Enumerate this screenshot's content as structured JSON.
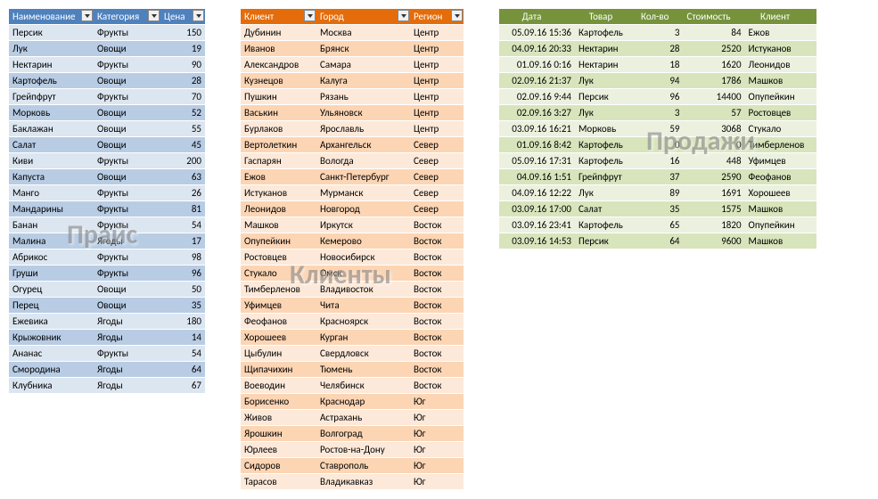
{
  "overlays": {
    "blue": "Прайс",
    "orange": "Клиенты",
    "green": "Продажи"
  },
  "blue": {
    "headers": [
      "Наименование",
      "Категория",
      "Цена"
    ],
    "rows": [
      [
        "Персик",
        "Фрукты",
        "150"
      ],
      [
        "Лук",
        "Овощи",
        "19"
      ],
      [
        "Нектарин",
        "Фрукты",
        "90"
      ],
      [
        "Картофель",
        "Овощи",
        "28"
      ],
      [
        "Грейпфрут",
        "Фрукты",
        "70"
      ],
      [
        "Морковь",
        "Овощи",
        "52"
      ],
      [
        "Баклажан",
        "Овощи",
        "55"
      ],
      [
        "Салат",
        "Овощи",
        "45"
      ],
      [
        "Киви",
        "Фрукты",
        "200"
      ],
      [
        "Капуста",
        "Овощи",
        "63"
      ],
      [
        "Манго",
        "Фрукты",
        "26"
      ],
      [
        "Мандарины",
        "Фрукты",
        "81"
      ],
      [
        "Банан",
        "Фрукты",
        "54"
      ],
      [
        "Малина",
        "Ягоды",
        "17"
      ],
      [
        "Абрикос",
        "Фрукты",
        "98"
      ],
      [
        "Груши",
        "Фрукты",
        "96"
      ],
      [
        "Огурец",
        "Овощи",
        "50"
      ],
      [
        "Перец",
        "Овощи",
        "35"
      ],
      [
        "Ежевика",
        "Ягоды",
        "180"
      ],
      [
        "Крыжовник",
        "Ягоды",
        "14"
      ],
      [
        "Ананас",
        "Фрукты",
        "54"
      ],
      [
        "Смородина",
        "Ягоды",
        "64"
      ],
      [
        "Клубника",
        "Ягоды",
        "67"
      ]
    ]
  },
  "orange": {
    "headers": [
      "Клиент",
      "Город",
      "Регион"
    ],
    "rows": [
      [
        "Дубинин",
        "Москва",
        "Центр"
      ],
      [
        "Иванов",
        "Брянск",
        "Центр"
      ],
      [
        "Александров",
        "Самара",
        "Центр"
      ],
      [
        "Кузнецов",
        "Калуга",
        "Центр"
      ],
      [
        "Пушкин",
        "Рязань",
        "Центр"
      ],
      [
        "Васькин",
        "Ульяновск",
        "Центр"
      ],
      [
        "Бурлаков",
        "Ярославль",
        "Центр"
      ],
      [
        "Вертолеткин",
        "Архангельск",
        "Север"
      ],
      [
        "Гаспарян",
        "Вологда",
        "Север"
      ],
      [
        "Ежов",
        "Санкт-Петербург",
        "Север"
      ],
      [
        "Истуканов",
        "Мурманск",
        "Север"
      ],
      [
        "Леонидов",
        "Новгород",
        "Север"
      ],
      [
        "Машков",
        "Иркутск",
        "Восток"
      ],
      [
        "Опупейкин",
        "Кемерово",
        "Восток"
      ],
      [
        "Ростовцев",
        "Новосибирск",
        "Восток"
      ],
      [
        "Стукало",
        "Омск",
        "Восток"
      ],
      [
        "Тимберленов",
        "Владивосток",
        "Восток"
      ],
      [
        "Уфимцев",
        "Чита",
        "Восток"
      ],
      [
        "Феофанов",
        "Красноярск",
        "Восток"
      ],
      [
        "Хорошеев",
        "Курган",
        "Восток"
      ],
      [
        "Цыбулин",
        "Свердловск",
        "Восток"
      ],
      [
        "Щипачихин",
        "Тюмень",
        "Восток"
      ],
      [
        "Воеводин",
        "Челябинск",
        "Восток"
      ],
      [
        "Борисенко",
        "Краснодар",
        "Юг"
      ],
      [
        "Живов",
        "Астрахань",
        "Юг"
      ],
      [
        "Ярошкин",
        "Волгоград",
        "Юг"
      ],
      [
        "Юрлеев",
        "Ростов-на-Дону",
        "Юг"
      ],
      [
        "Сидоров",
        "Ставрополь",
        "Юг"
      ],
      [
        "Тарасов",
        "Владикавказ",
        "Юг"
      ]
    ]
  },
  "green": {
    "headers": [
      "Дата",
      "Товар",
      "Кол-во",
      "Стоимость",
      "Клиент"
    ],
    "rows": [
      [
        "05.09.16 15:36",
        "Картофель",
        "3",
        "84",
        "Ежов"
      ],
      [
        "04.09.16 20:33",
        "Нектарин",
        "28",
        "2520",
        "Истуканов"
      ],
      [
        "01.09.16 0:16",
        "Нектарин",
        "18",
        "1620",
        "Леонидов"
      ],
      [
        "02.09.16 21:37",
        "Лук",
        "94",
        "1786",
        "Машков"
      ],
      [
        "02.09.16 9:44",
        "Персик",
        "96",
        "14400",
        "Опупейкин"
      ],
      [
        "02.09.16 3:27",
        "Лук",
        "3",
        "57",
        "Ростовцев"
      ],
      [
        "03.09.16 16:21",
        "Морковь",
        "59",
        "3068",
        "Стукало"
      ],
      [
        "01.09.16 8:42",
        "Картофель",
        "0",
        "0",
        "Тимберленов"
      ],
      [
        "05.09.16 17:31",
        "Картофель",
        "16",
        "448",
        "Уфимцев"
      ],
      [
        "04.09.16 1:51",
        "Грейпфрут",
        "37",
        "2590",
        "Феофанов"
      ],
      [
        "04.09.16 12:22",
        "Лук",
        "89",
        "1691",
        "Хорошеев"
      ],
      [
        "03.09.16 17:00",
        "Салат",
        "35",
        "1575",
        "Машков"
      ],
      [
        "03.09.16 23:41",
        "Картофель",
        "65",
        "1820",
        "Опупейкин"
      ],
      [
        "03.09.16 14:53",
        "Персик",
        "64",
        "9600",
        "Машков"
      ]
    ]
  },
  "chart_data": [
    {
      "type": "table",
      "title": "Прайс",
      "columns": [
        "Наименование",
        "Категория",
        "Цена"
      ],
      "rows": [
        {
          "Наименование": "Персик",
          "Категория": "Фрукты",
          "Цена": 150
        },
        {
          "Наименование": "Лук",
          "Категория": "Овощи",
          "Цена": 19
        },
        {
          "Наименование": "Нектарин",
          "Категория": "Фрукты",
          "Цена": 90
        },
        {
          "Наименование": "Картофель",
          "Категория": "Овощи",
          "Цена": 28
        },
        {
          "Наименование": "Грейпфрут",
          "Категория": "Фрукты",
          "Цена": 70
        },
        {
          "Наименование": "Морковь",
          "Категория": "Овощи",
          "Цена": 52
        },
        {
          "Наименование": "Баклажан",
          "Категория": "Овощи",
          "Цена": 55
        },
        {
          "Наименование": "Салат",
          "Категория": "Овощи",
          "Цена": 45
        },
        {
          "Наименование": "Киви",
          "Категория": "Фрукты",
          "Цена": 200
        },
        {
          "Наименование": "Капуста",
          "Категория": "Овощи",
          "Цена": 63
        },
        {
          "Наименование": "Манго",
          "Категория": "Фрукты",
          "Цена": 26
        },
        {
          "Наименование": "Мандарины",
          "Категория": "Фрукты",
          "Цена": 81
        },
        {
          "Наименование": "Банан",
          "Категория": "Фрукты",
          "Цена": 54
        },
        {
          "Наименование": "Малина",
          "Категория": "Ягоды",
          "Цена": 17
        },
        {
          "Наименование": "Абрикос",
          "Категория": "Фрукты",
          "Цена": 98
        },
        {
          "Наименование": "Груши",
          "Категория": "Фрукты",
          "Цена": 96
        },
        {
          "Наименование": "Огурец",
          "Категория": "Овощи",
          "Цена": 50
        },
        {
          "Наименование": "Перец",
          "Категория": "Овощи",
          "Цена": 35
        },
        {
          "Наименование": "Ежевика",
          "Категория": "Ягоды",
          "Цена": 180
        },
        {
          "Наименование": "Крыжовник",
          "Категория": "Ягоды",
          "Цена": 14
        },
        {
          "Наименование": "Ананас",
          "Категория": "Фрукты",
          "Цена": 54
        },
        {
          "Наименование": "Смородина",
          "Категория": "Ягоды",
          "Цена": 64
        },
        {
          "Наименование": "Клубника",
          "Категория": "Ягоды",
          "Цена": 67
        }
      ]
    },
    {
      "type": "table",
      "title": "Клиенты",
      "columns": [
        "Клиент",
        "Город",
        "Регион"
      ],
      "rows": [
        {
          "Клиент": "Дубинин",
          "Город": "Москва",
          "Регион": "Центр"
        },
        {
          "Клиент": "Иванов",
          "Город": "Брянск",
          "Регион": "Центр"
        },
        {
          "Клиент": "Александров",
          "Город": "Самара",
          "Регион": "Центр"
        },
        {
          "Клиент": "Кузнецов",
          "Город": "Калуга",
          "Регион": "Центр"
        },
        {
          "Клиент": "Пушкин",
          "Город": "Рязань",
          "Регион": "Центр"
        },
        {
          "Клиент": "Васькин",
          "Город": "Ульяновск",
          "Регион": "Центр"
        },
        {
          "Клиент": "Бурлаков",
          "Город": "Ярославль",
          "Регион": "Центр"
        },
        {
          "Клиент": "Вертолеткин",
          "Город": "Архангельск",
          "Регион": "Север"
        },
        {
          "Клиент": "Гаспарян",
          "Город": "Вологда",
          "Регион": "Север"
        },
        {
          "Клиент": "Ежов",
          "Город": "Санкт-Петербург",
          "Регион": "Север"
        },
        {
          "Клиент": "Истуканов",
          "Город": "Мурманск",
          "Регион": "Север"
        },
        {
          "Клиент": "Леонидов",
          "Город": "Новгород",
          "Регион": "Север"
        },
        {
          "Клиент": "Машков",
          "Город": "Иркутск",
          "Регион": "Восток"
        },
        {
          "Клиент": "Опупейкин",
          "Город": "Кемерово",
          "Регион": "Восток"
        },
        {
          "Клиент": "Ростовцев",
          "Город": "Новосибирск",
          "Регион": "Восток"
        },
        {
          "Клиент": "Стукало",
          "Город": "Омск",
          "Регион": "Восток"
        },
        {
          "Клиент": "Тимберленов",
          "Город": "Владивосток",
          "Регион": "Восток"
        },
        {
          "Клиент": "Уфимцев",
          "Город": "Чита",
          "Регион": "Восток"
        },
        {
          "Клиент": "Феофанов",
          "Город": "Красноярск",
          "Регион": "Восток"
        },
        {
          "Клиент": "Хорошеев",
          "Город": "Курган",
          "Регион": "Восток"
        },
        {
          "Клиент": "Цыбулин",
          "Город": "Свердловск",
          "Регион": "Восток"
        },
        {
          "Клиент": "Щипачихин",
          "Город": "Тюмень",
          "Регион": "Восток"
        },
        {
          "Клиент": "Воеводин",
          "Город": "Челябинск",
          "Регион": "Восток"
        },
        {
          "Клиент": "Борисенко",
          "Город": "Краснодар",
          "Регион": "Юг"
        },
        {
          "Клиент": "Живов",
          "Город": "Астрахань",
          "Регион": "Юг"
        },
        {
          "Клиент": "Ярошкин",
          "Город": "Волгоград",
          "Регион": "Юг"
        },
        {
          "Клиент": "Юрлеев",
          "Город": "Ростов-на-Дону",
          "Регион": "Юг"
        },
        {
          "Клиент": "Сидоров",
          "Город": "Ставрополь",
          "Регион": "Юг"
        },
        {
          "Клиент": "Тарасов",
          "Город": "Владикавказ",
          "Регион": "Юг"
        }
      ]
    },
    {
      "type": "table",
      "title": "Продажи",
      "columns": [
        "Дата",
        "Товар",
        "Кол-во",
        "Стоимость",
        "Клиент"
      ],
      "rows": [
        {
          "Дата": "05.09.16 15:36",
          "Товар": "Картофель",
          "Кол-во": 3,
          "Стоимость": 84,
          "Клиент": "Ежов"
        },
        {
          "Дата": "04.09.16 20:33",
          "Товар": "Нектарин",
          "Кол-во": 28,
          "Стоимость": 2520,
          "Клиент": "Истуканов"
        },
        {
          "Дата": "01.09.16 0:16",
          "Товар": "Нектарин",
          "Кол-во": 18,
          "Стоимость": 1620,
          "Клиент": "Леонидов"
        },
        {
          "Дата": "02.09.16 21:37",
          "Товар": "Лук",
          "Кол-во": 94,
          "Стоимость": 1786,
          "Клиент": "Машков"
        },
        {
          "Дата": "02.09.16 9:44",
          "Товар": "Персик",
          "Кол-во": 96,
          "Стоимость": 14400,
          "Клиент": "Опупейкин"
        },
        {
          "Дата": "02.09.16 3:27",
          "Товар": "Лук",
          "Кол-во": 3,
          "Стоимость": 57,
          "Клиент": "Ростовцев"
        },
        {
          "Дата": "03.09.16 16:21",
          "Товар": "Морковь",
          "Кол-во": 59,
          "Стоимость": 3068,
          "Клиент": "Стукало"
        },
        {
          "Дата": "01.09.16 8:42",
          "Товар": "Картофель",
          "Кол-во": 0,
          "Стоимость": 0,
          "Клиент": "Тимберленов"
        },
        {
          "Дата": "05.09.16 17:31",
          "Товар": "Картофель",
          "Кол-во": 16,
          "Стоимость": 448,
          "Клиент": "Уфимцев"
        },
        {
          "Дата": "04.09.16 1:51",
          "Товар": "Грейпфрут",
          "Кол-во": 37,
          "Стоимость": 2590,
          "Клиент": "Феофанов"
        },
        {
          "Дата": "04.09.16 12:22",
          "Товар": "Лук",
          "Кол-во": 89,
          "Стоимость": 1691,
          "Клиент": "Хорошеев"
        },
        {
          "Дата": "03.09.16 17:00",
          "Товар": "Салат",
          "Кол-во": 35,
          "Стоимость": 1575,
          "Клиент": "Машков"
        },
        {
          "Дата": "03.09.16 23:41",
          "Товар": "Картофель",
          "Кол-во": 65,
          "Стоимость": 1820,
          "Клиент": "Опупейкин"
        },
        {
          "Дата": "03.09.16 14:53",
          "Товар": "Персик",
          "Кол-во": 64,
          "Стоимость": 9600,
          "Клиент": "Машков"
        }
      ]
    }
  ]
}
